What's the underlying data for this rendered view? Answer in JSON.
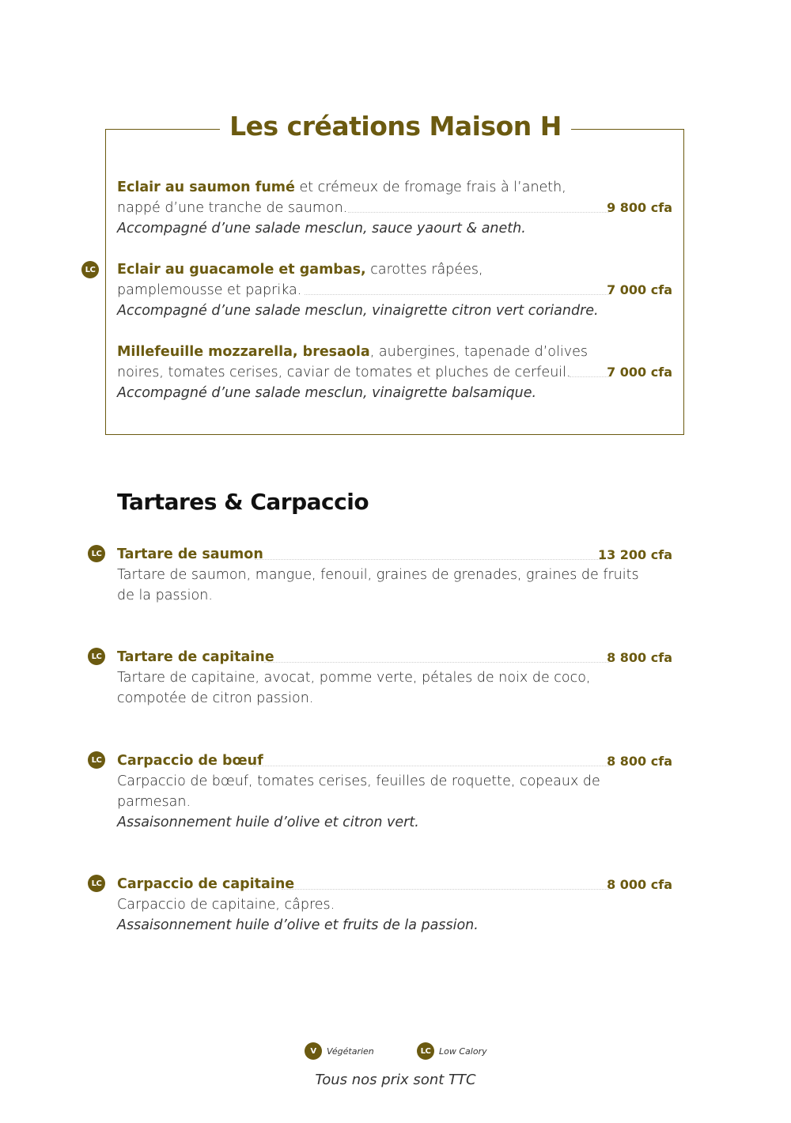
{
  "creations": {
    "title": "Les créations Maison H",
    "items": [
      {
        "name": "Eclair au saumon fumé",
        "desc1": " et crémeux de fromage frais à l’aneth,",
        "desc2": "nappé d’une tranche de saumon.",
        "accomp": "Accompagné d’une salade mesclun, sauce yaourt & aneth.",
        "price": "9 800 cfa"
      },
      {
        "badge": "LC",
        "name": "Eclair au guacamole et gambas,",
        "desc1": " carottes râpées,",
        "desc2": "pamplemousse et paprika.",
        "accomp": "Accompagné d’une salade mesclun, vinaigrette citron vert coriandre.",
        "price": "7 000 cfa"
      },
      {
        "name": "Millefeuille mozzarella, bresaola",
        "desc1": ", aubergines, tapenade d’olives",
        "desc2": "noires, tomates cerises, caviar de tomates et pluches de cerfeuil.",
        "accomp": "Accompagné d’une salade mesclun, vinaigrette balsamique.",
        "price": "7 000 cfa"
      }
    ]
  },
  "tartares": {
    "title": "Tartares & Carpaccio",
    "items": [
      {
        "badge": "LC",
        "name": "Tartare de saumon",
        "price": "13 200 cfa",
        "desc1": "Tartare de saumon, mangue, fenouil, graines de grenades, graines de fruits",
        "desc2": "de la passion."
      },
      {
        "badge": "LC",
        "name": "Tartare de capitaine",
        "price": "8 800 cfa",
        "desc1": "Tartare de capitaine, avocat, pomme verte, pétales de noix de coco,",
        "desc2": "compotée de citron passion."
      },
      {
        "badge": "LC",
        "name": "Carpaccio de bœuf",
        "price": "8 800 cfa",
        "desc1": "Carpaccio de bœuf, tomates cerises, feuilles de roquette, copeaux de",
        "desc2": "parmesan.",
        "accomp": "Assaisonnement huile d’olive et citron vert."
      },
      {
        "badge": "LC",
        "name": "Carpaccio de capitaine",
        "price": "8 000 cfa",
        "desc1": "Carpaccio de capitaine, câpres.",
        "accomp": "Assaisonnement huile d’olive et fruits de la passion."
      }
    ]
  },
  "legend": {
    "veg_badge": "V",
    "veg_label": "Végétarien",
    "lc_badge": "LC",
    "lc_label": "Low Calory"
  },
  "footer": "Tous nos prix sont TTC"
}
